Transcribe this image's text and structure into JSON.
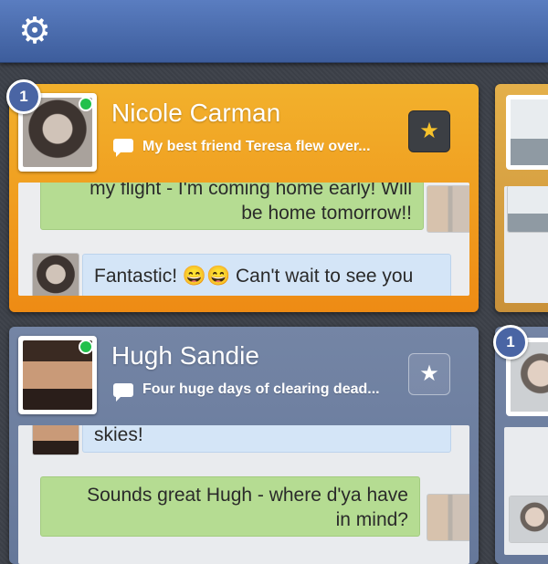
{
  "topbar": {
    "settings_icon": "gear-icon",
    "settings_glyph": "⚙"
  },
  "icons": {
    "star": "★"
  },
  "cards": [
    {
      "name": "Nicole Carman",
      "online": true,
      "badge": "1",
      "preview": "My best friend Teresa flew over...",
      "starred": true,
      "messages": [
        {
          "text_line1": "my flight - I'm coming home early! Will",
          "text_line2": "be home tomorrow!!",
          "direction": "outgoing"
        },
        {
          "text": "Fantastic! 😄😄 Can't wait to see you 😘",
          "direction": "incoming"
        }
      ]
    },
    {
      "name": "Hugh Sandie",
      "online": true,
      "badge": "",
      "preview": "Four huge days of clearing dead...",
      "starred": false,
      "messages": [
        {
          "text": "skies!",
          "direction": "incoming"
        },
        {
          "text_line1": "Sounds great Hugh - where d'ya have",
          "text_line2": "in mind?",
          "direction": "outgoing"
        }
      ]
    }
  ],
  "right_badge": "1",
  "colors": {
    "accent_blue": "#4a65a4",
    "orange": "#ee8b14",
    "online_green": "#22c04b"
  }
}
